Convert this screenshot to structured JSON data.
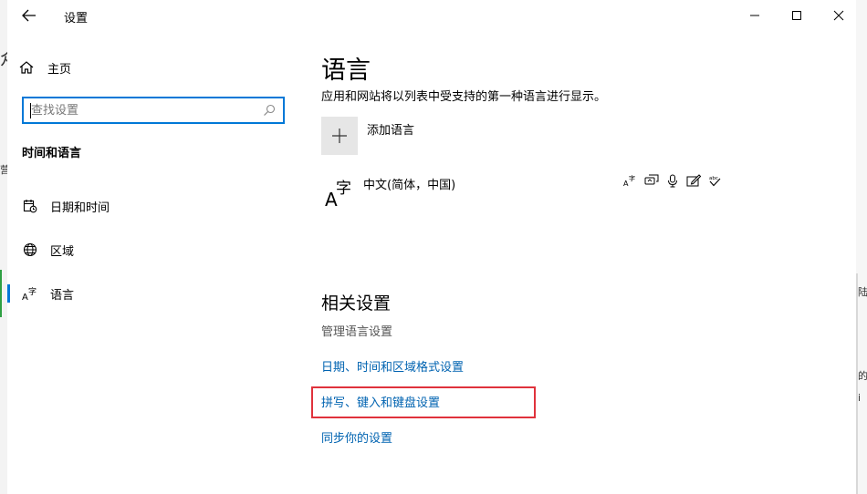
{
  "window": {
    "title": "设置"
  },
  "sidebar": {
    "home_label": "主页",
    "search_placeholder": "查找设置",
    "section_title": "时间和语言",
    "items": [
      {
        "label": "日期和时间",
        "icon": "calendar-clock-icon"
      },
      {
        "label": "区域",
        "icon": "globe-icon"
      },
      {
        "label": "语言",
        "icon": "language-icon",
        "selected": true
      }
    ]
  },
  "main": {
    "title": "语言",
    "description": "应用和网站将以列表中受支持的第一种语言进行显示。",
    "add_language_label": "添加语言",
    "languages": [
      {
        "name": "中文(简体，中国)",
        "features": [
          "display-language-icon",
          "speech-icon",
          "microphone-icon",
          "handwriting-icon",
          "spellcheck-icon"
        ]
      }
    ],
    "related": {
      "title": "相关设置",
      "subtitle": "管理语言设置",
      "links": [
        "日期、时间和区域格式设置",
        "拼写、键入和键盘设置",
        "同步你的设置"
      ]
    }
  },
  "colors": {
    "accent": "#0078d7",
    "link": "#0063b1",
    "highlight": "#e0323c"
  }
}
